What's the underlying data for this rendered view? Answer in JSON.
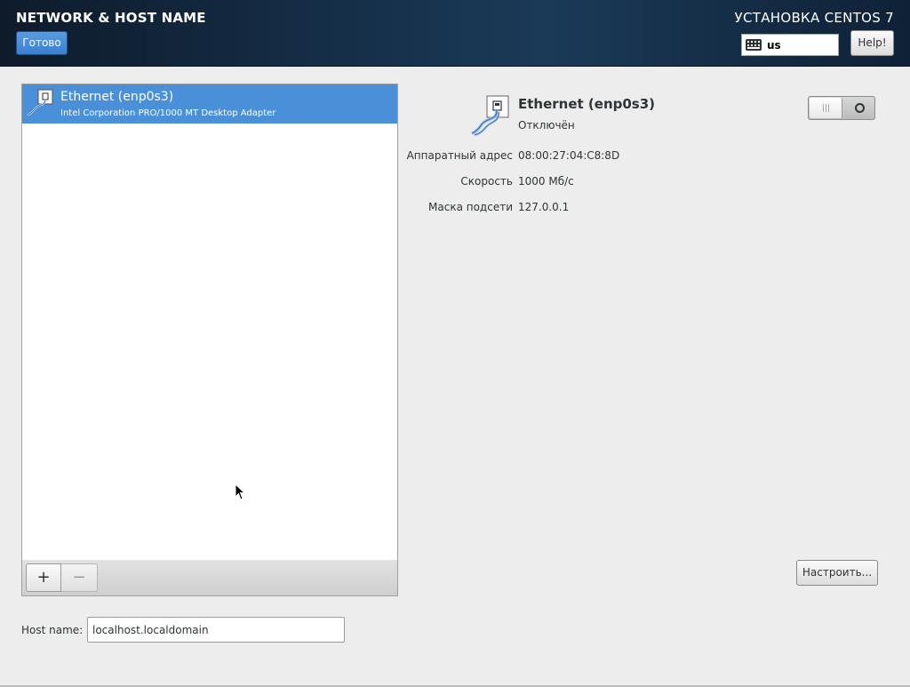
{
  "header": {
    "title": "NETWORK & HOST NAME",
    "done_label": "Готово",
    "product_title": "УСТАНОВКА CENTOS 7",
    "keyboard_layout": "us",
    "help_label": "Help!"
  },
  "devices": [
    {
      "name": "Ethernet (enp0s3)",
      "description": "Intel Corporation PRO/1000 MT Desktop Adapter",
      "selected": true
    }
  ],
  "toolbar": {
    "add_label": "+",
    "remove_label": "−"
  },
  "detail": {
    "name": "Ethernet (enp0s3)",
    "status": "Отключён",
    "enabled": false,
    "properties": [
      {
        "label": "Аппаратный адрес",
        "value": "08:00:27:04:C8:8D"
      },
      {
        "label": "Скорость",
        "value": "1000 Мб/с"
      },
      {
        "label": "Маска подсети",
        "value": "127.0.0.1"
      }
    ],
    "configure_label": "Настроить..."
  },
  "hostname": {
    "label": "Host name:",
    "value": "localhost.localdomain"
  },
  "colors": {
    "selection": "#4a90d9",
    "header_bg": "#16304a"
  }
}
